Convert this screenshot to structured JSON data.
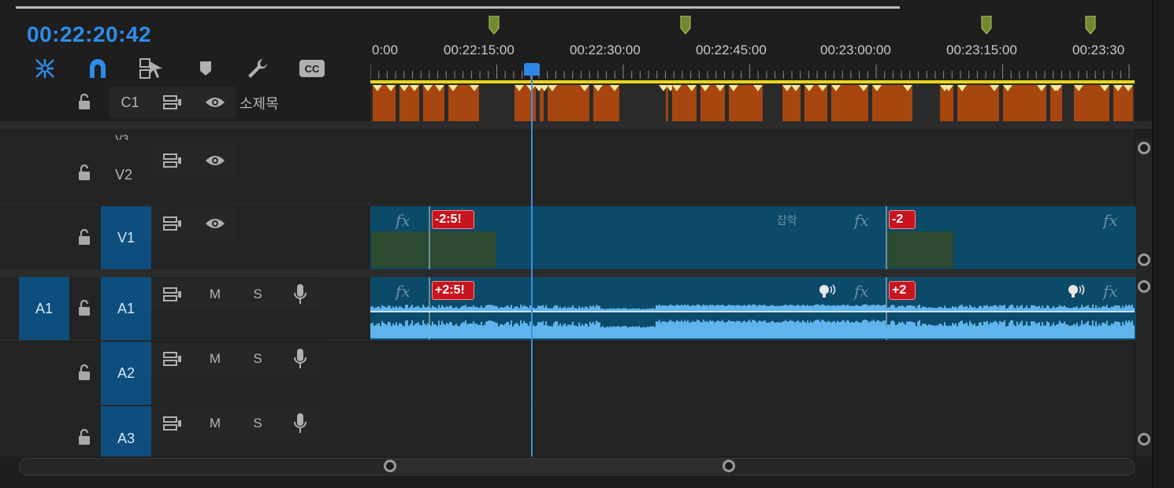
{
  "timecode": "00:22:20:42",
  "toolbar": {
    "icons": [
      "snap-icon",
      "magnet-icon",
      "linked-selection-icon",
      "marker-icon",
      "wrench-icon",
      "captions-icon"
    ],
    "cc_label": "CC"
  },
  "ruler": {
    "labels": [
      "0:00",
      "00:22:15:00",
      "00:22:30:00",
      "00:22:45:00",
      "00:23:00:00",
      "00:23:15:00",
      "00:23:30"
    ]
  },
  "tracks": {
    "c1": {
      "label": "C1",
      "title": "소제목"
    },
    "v3_partial": "V3",
    "v2": {
      "label": "V2"
    },
    "v1": {
      "label": "V1"
    },
    "a1": {
      "label": "A1",
      "source": "A1",
      "mute": "M",
      "solo": "S"
    },
    "a2": {
      "label": "A2",
      "mute": "M",
      "solo": "S"
    },
    "a3": {
      "label": "A3",
      "mute": "M",
      "solo": "S"
    }
  },
  "clips": {
    "fx_label": "fx",
    "v1_badge_1": "-2:5!",
    "v1_badge_2": "-2",
    "a1_badge_1": "+2:5!",
    "a1_badge_2": "+2",
    "v1_overlay_text": "잡학"
  },
  "colors": {
    "timecode": "#2d8ceb",
    "track_target": "#0e4e7e",
    "clip": "#0b4a68",
    "audio_wave": "#5fb4ec",
    "caption_clip": "#a8460f",
    "workarea": "#e9d51c",
    "playhead": "#3a8ee6",
    "badge": "#c8141e"
  }
}
